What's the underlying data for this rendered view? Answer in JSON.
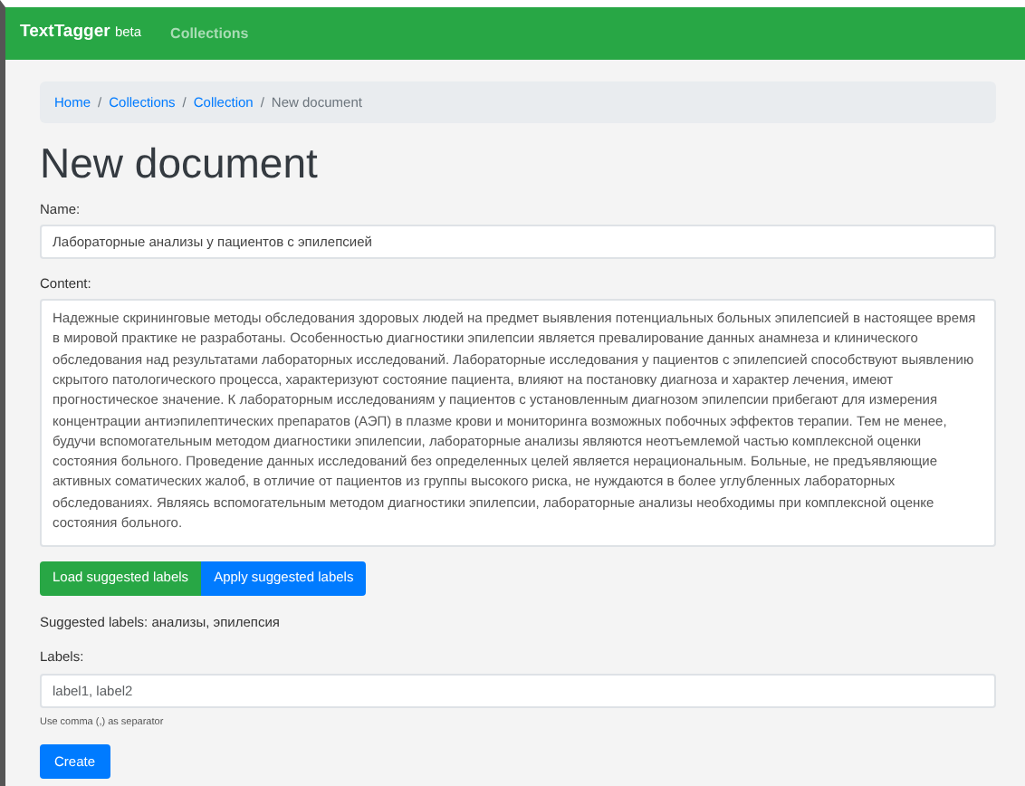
{
  "navbar": {
    "brand": "TextTagger",
    "brand_tag": "beta",
    "links": [
      {
        "label": "Collections",
        "selected": false
      }
    ]
  },
  "breadcrumb_separator": "/",
  "breadcrumb": [
    {
      "label": "Home",
      "selected": false
    },
    {
      "label": "Collections",
      "selected": false
    },
    {
      "label": "Collection",
      "selected": false
    },
    {
      "label": "New document",
      "selected": true
    }
  ],
  "title": "New document",
  "name_field": {
    "label": "Name:",
    "value": "Лабораторные анализы у пациентов с эпилепсией"
  },
  "content_field": {
    "label": "Content:",
    "value": "Надежные скрининговые методы обследования здоровых людей на предмет выявления потенциальных больных эпилепсией в настоящее время в мировой практике не разработаны. Особенностью диагностики эпилепсии является превалирование данных анамнеза и клинического обследования над результатами лабораторных исследований. Лабораторные исследования у пациентов с эпилепсией способствуют выявлению скрытого патологического процесса, характеризуют состояние пациента, влияют на постановку диагноза и характер лечения, имеют прогностическое значение. К лабораторным исследованиям у пациентов с установленным диагнозом эпилепсии прибегают для измерения концентрации антиэпилептических препаратов (АЭП) в плазме крови и мониторинга возможных побочных эффектов терапии. Тем не менее, будучи вспомогательным методом диагностики эпилепсии, лабораторные анализы являются неотъемлемой частью комплексной оценки состояния больного. Проведение данных исследований без определенных целей является нерациональным. Больные, не предъявляющие активных соматических жалоб, в отличие от пациентов из группы высокого риска, не нуждаются в более углубленных лабораторных обследованиях. Являясь вспомогательным методом диагностики эпилепсии, лабораторные анализы необходимы при комплексной оценке состояния больного."
  },
  "label_buttons": [
    {
      "label": "Load suggested labels",
      "kind": "success"
    },
    {
      "label": "Apply suggested labels",
      "kind": "primary"
    }
  ],
  "suggested_labels": "Suggested labels: анализы, эпилепсия",
  "labels_field": {
    "label": "Labels:",
    "placeholder": "label1, label2",
    "hint": "Use comma (,) as separator"
  },
  "submit": "Create"
}
